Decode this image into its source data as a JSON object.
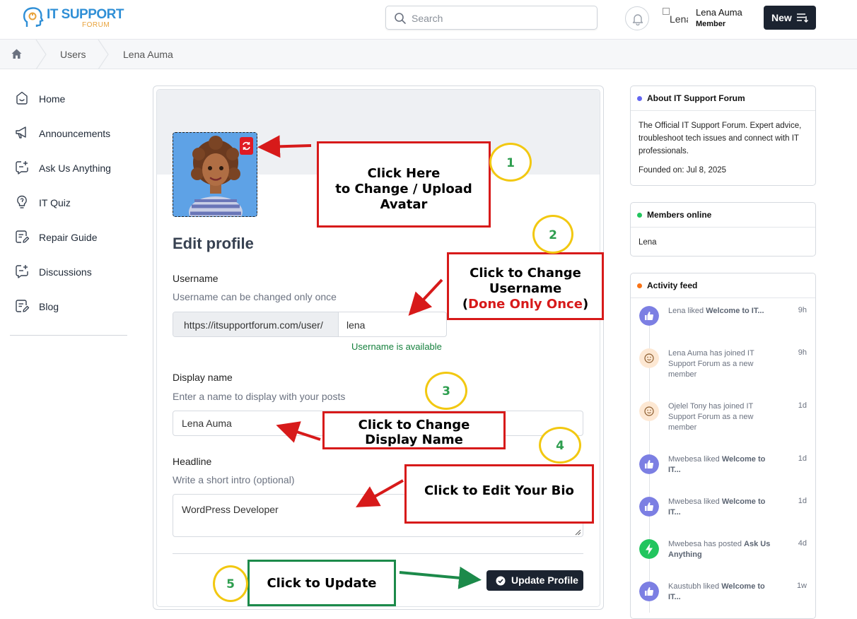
{
  "header": {
    "logo_line1": "IT SUPPORT",
    "logo_line2": "FORUM",
    "search_placeholder": "Search",
    "user_avatar_alt": "Lena",
    "user_name": "Lena Auma",
    "user_role": "Member",
    "new_button": "New"
  },
  "breadcrumb": {
    "items": [
      "Users",
      "Lena Auma"
    ]
  },
  "sidebar": {
    "items": [
      {
        "label": "Home",
        "icon": "home-icon"
      },
      {
        "label": "Announcements",
        "icon": "megaphone-icon"
      },
      {
        "label": "Ask Us Anything",
        "icon": "chat-plus-icon"
      },
      {
        "label": "IT Quiz",
        "icon": "lightbulb-icon"
      },
      {
        "label": "Repair Guide",
        "icon": "note-edit-icon"
      },
      {
        "label": "Discussions",
        "icon": "chat-plus-icon"
      },
      {
        "label": "Blog",
        "icon": "note-edit-icon"
      }
    ]
  },
  "form": {
    "title": "Edit profile",
    "username_label": "Username",
    "username_help": "Username can be changed only once",
    "username_prefix": "https://itsupportforum.com/user/",
    "username_value": "lena",
    "username_status": "Username is available",
    "display_label": "Display name",
    "display_help": "Enter a name to display with your posts",
    "display_value": "Lena Auma",
    "headline_label": "Headline",
    "headline_help": "Write a short intro (optional)",
    "headline_value": "WordPress Developer",
    "update_button": "Update Profile"
  },
  "widgets": {
    "about": {
      "title": "About IT Support Forum",
      "description": "The Official IT Support Forum. Expert advice, troubleshoot tech issues and connect with IT professionals.",
      "founded": "Founded on: Jul 8, 2025",
      "dot_color": "#6366f1"
    },
    "members": {
      "title": "Members online",
      "names": "Lena",
      "dot_color": "#22c55e"
    },
    "activity": {
      "title": "Activity feed",
      "dot_color": "#f97316",
      "items": [
        {
          "text": "Lena liked ",
          "bold": "Welcome to IT...",
          "time": "9h",
          "icon": "thumbs-up-icon"
        },
        {
          "text": "Lena Auma has joined IT Support Forum as a new member",
          "bold": "",
          "time": "9h",
          "icon": "smile-icon"
        },
        {
          "text": "Ojelel Tony has joined IT Support Forum as a new member",
          "bold": "",
          "time": "1d",
          "icon": "smile-icon"
        },
        {
          "text": "Mwebesa liked ",
          "bold": "Welcome to IT...",
          "time": "1d",
          "icon": "thumbs-up-icon"
        },
        {
          "text": "Mwebesa liked ",
          "bold": "Welcome to IT...",
          "time": "1d",
          "icon": "thumbs-up-icon"
        },
        {
          "text": "Mwebesa has posted ",
          "bold": "Ask Us Anything",
          "time": "4d",
          "icon": "bolt-icon"
        },
        {
          "text": "Kaustubh liked ",
          "bold": "Welcome to IT...",
          "time": "1w",
          "icon": "thumbs-up-icon"
        }
      ]
    }
  },
  "annotations": {
    "step1": {
      "number": "1",
      "line1": "Click Here",
      "line2": "to Change / Upload",
      "line3": "Avatar"
    },
    "step2": {
      "number": "2",
      "line1": "Click to Change",
      "line2": "Username",
      "paren_open": "(",
      "red": "Done Only Once",
      "paren_close": ")"
    },
    "step3": {
      "number": "3",
      "line1": "Click to Change",
      "line2": "Display Name"
    },
    "step4": {
      "number": "4",
      "line1": "Click to Edit Your Bio"
    },
    "step5": {
      "number": "5",
      "line1": "Click to Update"
    }
  }
}
